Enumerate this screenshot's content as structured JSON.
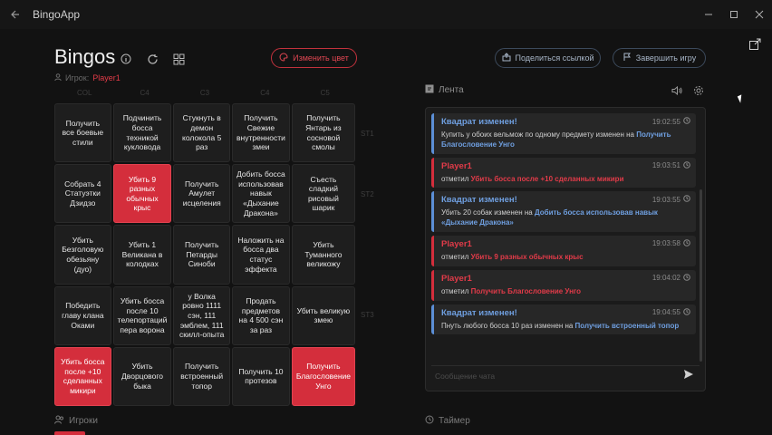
{
  "app": {
    "title": "BingoApp"
  },
  "header": {
    "title": "Bingos",
    "player_label": "Игрок:",
    "player_name": "Player1",
    "change_color": "Изменить цвет",
    "share_link": "Поделиться ссылкой",
    "finish_game": "Завершить игру"
  },
  "board": {
    "col_headers": [
      "COL",
      "C4",
      "C3",
      "C4",
      "C5"
    ],
    "row_headers": [
      "ST1",
      "ST2",
      "",
      "ST3",
      ""
    ],
    "cells": [
      {
        "label": "Получить все боевые стили",
        "marked": false
      },
      {
        "label": "Подчинить босса техникой кукловода",
        "marked": false
      },
      {
        "label": "Стукнуть в демон колокола 5 раз",
        "marked": false
      },
      {
        "label": "Получить Свежие внутренности змеи",
        "marked": false
      },
      {
        "label": "Получить Янтарь из сосновой смолы",
        "marked": false
      },
      {
        "label": "Собрать 4 Статуэтки Дзидзо",
        "marked": false
      },
      {
        "label": "Убить 9 разных обычных крыс",
        "marked": true
      },
      {
        "label": "Получить Амулет исцеления",
        "marked": false
      },
      {
        "label": "Добить босса использовав навык «Дыхание Дракона»",
        "marked": false
      },
      {
        "label": "Съесть сладкий рисовый шарик",
        "marked": false
      },
      {
        "label": "Убить Безголовую обезьяну (дуо)",
        "marked": false
      },
      {
        "label": "Убить 1 Великана в колодках",
        "marked": false
      },
      {
        "label": "Получить Петарды Синоби",
        "marked": false
      },
      {
        "label": "Наложить на босса два статус эффекта",
        "marked": false
      },
      {
        "label": "Убить Туманного великожу",
        "marked": false
      },
      {
        "label": "Победить главу клана Оками",
        "marked": false
      },
      {
        "label": "Убить босса после 10 телепортаций пера ворона",
        "marked": false
      },
      {
        "label": "у Волка ровно 1111 сэн, 111 эмблем, 111 скилл-опыта",
        "marked": false
      },
      {
        "label": "Продать предметов на 4 500 сэн за раз",
        "marked": false
      },
      {
        "label": "Убить великую змею",
        "marked": false
      },
      {
        "label": "Убить босса после +10 сделанных микири",
        "marked": true
      },
      {
        "label": "Убить Дворцового быка",
        "marked": false
      },
      {
        "label": "Получить встроенный топор",
        "marked": false
      },
      {
        "label": "Получить 10 протезов",
        "marked": false
      },
      {
        "label": "Получить Благословение Унго",
        "marked": true
      }
    ]
  },
  "feed": {
    "title": "Лента",
    "chat_placeholder": "Сообщение чата",
    "messages": [
      {
        "title": "Квадрат изменен!",
        "time": "19:02:55",
        "pre": "Купить у обоих вельмож по одному предмету  изменен на ",
        "highlight": "Получить Благословение Унго",
        "color": "blue"
      },
      {
        "title": "Player1",
        "time": "19:03:51",
        "pre": "отметил ",
        "highlight": "Убить босса после +10 сделанных микири",
        "color": "red"
      },
      {
        "title": "Квадрат изменен!",
        "time": "19:03:55",
        "pre": "Убить 20 собак изменен на ",
        "highlight": "Добить босса использовав навык «Дыхание Дракона»",
        "color": "blue"
      },
      {
        "title": "Player1",
        "time": "19:03:58",
        "pre": "отметил ",
        "highlight": "Убить 9 разных обычных крыс",
        "color": "red"
      },
      {
        "title": "Player1",
        "time": "19:04:02",
        "pre": "отметил ",
        "highlight": "Получить Благословение Унго",
        "color": "red"
      },
      {
        "title": "Квадрат изменен!",
        "time": "19:04:55",
        "pre": "Пнуть любого босса 10 раз  изменен на ",
        "highlight": "Получить встроенный топор",
        "color": "blue"
      }
    ]
  },
  "footer": {
    "players": "Игроки",
    "timer": "Таймер"
  },
  "colors": {
    "accent": "#d42e3c",
    "info": "#6f9fe0",
    "background": "#121212"
  }
}
